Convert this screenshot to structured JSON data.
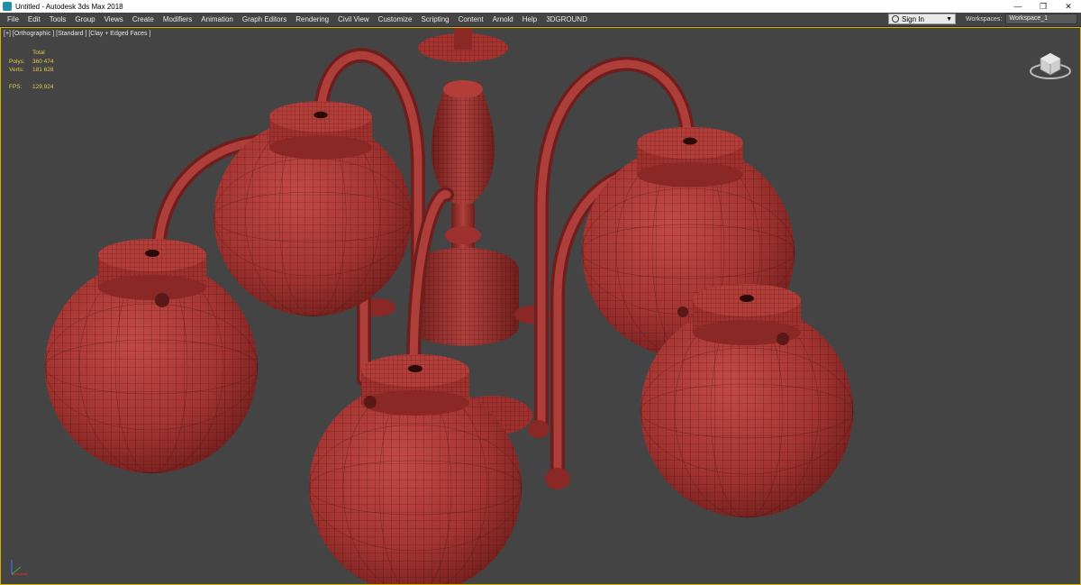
{
  "window": {
    "title": "Untitled - Autodesk 3ds Max 2018",
    "minimize": "—",
    "maximize": "❐",
    "close": "✕"
  },
  "menu": [
    "File",
    "Edit",
    "Tools",
    "Group",
    "Views",
    "Create",
    "Modifiers",
    "Animation",
    "Graph Editors",
    "Rendering",
    "Civil View",
    "Customize",
    "Scripting",
    "Content",
    "Arnold",
    "Help",
    "3DGROUND"
  ],
  "account": {
    "sign_in": "Sign In"
  },
  "workspaces": {
    "label": "Workspaces:",
    "value": "Workspace_1"
  },
  "viewport": {
    "label": "[+] [Orthographic ] [Standard ] [Clay + Edged Faces ]",
    "stats": {
      "header": "Total",
      "polys_label": "Polys:",
      "polys": "360 474",
      "verts_label": "Verts:",
      "verts": "181 628",
      "fps_label": "FPS:",
      "fps": "129,924"
    }
  },
  "colors": {
    "viewport_bg": "#444444",
    "clay": "#a63532",
    "wire": "#3a0f0e",
    "active_border": "#d4b000",
    "stats": "#e0c84a"
  }
}
